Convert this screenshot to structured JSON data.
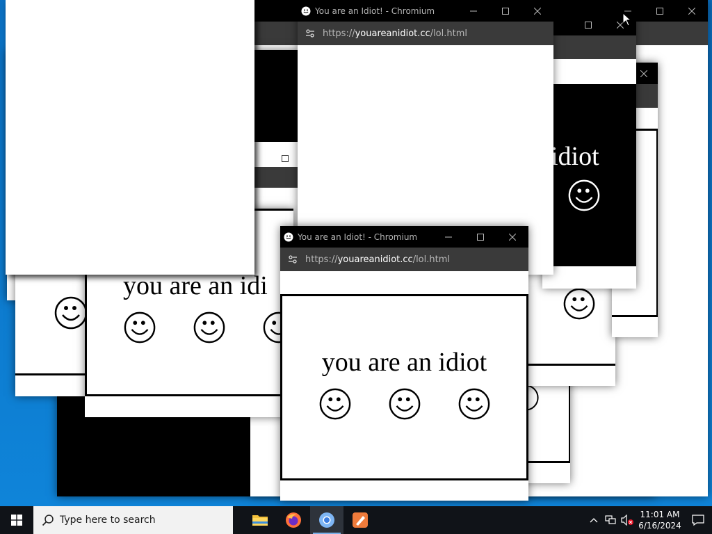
{
  "window": {
    "title": "You are an Idiot! - Chromium",
    "url_prefix": "https://",
    "url_domain": "youareanidiot.cc",
    "url_path": "/lol.html"
  },
  "content": {
    "idiot_text": "you are an idiot",
    "partial_text": "you are an idi",
    "partial_text_right": "idiot"
  },
  "taskbar": {
    "search_placeholder": "Type here to search",
    "time": "11:01 AM",
    "date": "6/16/2024",
    "apps": [
      "File Explorer",
      "Firefox",
      "Chromium",
      "Paint"
    ]
  },
  "icons": {
    "start": "windows-logo-icon",
    "search": "search-icon",
    "smiley": "smiley-icon",
    "minimize": "minimize-icon",
    "maximize": "maximize-icon",
    "close": "close-icon",
    "site_settings": "site-settings-icon"
  },
  "colors": {
    "desktop": "#0b6fc0",
    "titlebar": "#000000",
    "urlbar": "#3a3a3a",
    "taskbar": "#101318"
  }
}
